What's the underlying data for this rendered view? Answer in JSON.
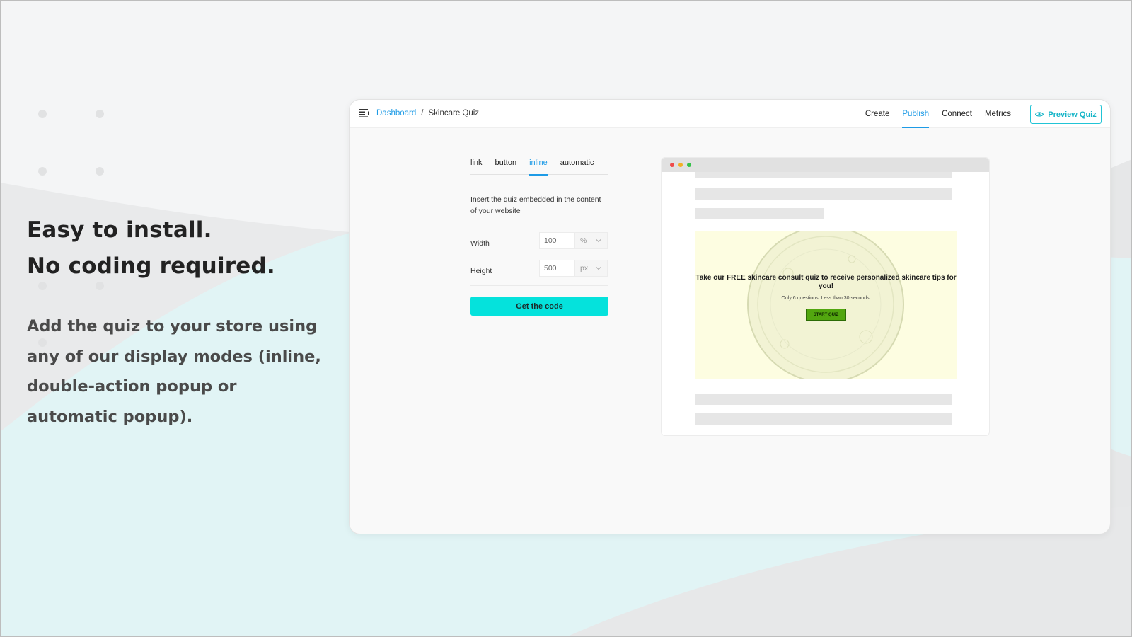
{
  "marketing": {
    "headline_line1": "Easy to install.",
    "headline_line2": "No coding required.",
    "subcopy": "Add the quiz to your store using any of our display modes (inline, double-action popup or automatic popup)."
  },
  "app": {
    "menu_icon": "hamburger-menu-icon",
    "breadcrumb": {
      "parent": "Dashboard",
      "separator": "/",
      "current": "Skincare Quiz"
    },
    "nav": [
      {
        "label": "Create",
        "active": false
      },
      {
        "label": "Publish",
        "active": true
      },
      {
        "label": "Connect",
        "active": false
      },
      {
        "label": "Metrics",
        "active": false
      }
    ],
    "preview_button": {
      "label": "Preview Quiz",
      "icon": "eye-icon"
    },
    "accent_color": "#1e9be6",
    "button_color": "#05e2dc"
  },
  "publish": {
    "tabs": [
      {
        "label": "link",
        "active": false
      },
      {
        "label": "button",
        "active": false
      },
      {
        "label": "inline",
        "active": true
      },
      {
        "label": "automatic",
        "active": false
      }
    ],
    "description": "Insert the quiz embedded in the content of your website",
    "width": {
      "label": "Width",
      "value": "100",
      "unit": "%"
    },
    "height": {
      "label": "Height",
      "value": "500",
      "unit": "px"
    },
    "get_code_label": "Get the code"
  },
  "preview": {
    "quiz_title": "Take our FREE skincare consult quiz to receive personalized skincare tips for you!",
    "quiz_subtitle": "Only 6 questions. Less than 30 seconds.",
    "quiz_button": "START QUIZ",
    "quiz_background": "#fdfde1",
    "quiz_button_color": "#52a60f"
  }
}
